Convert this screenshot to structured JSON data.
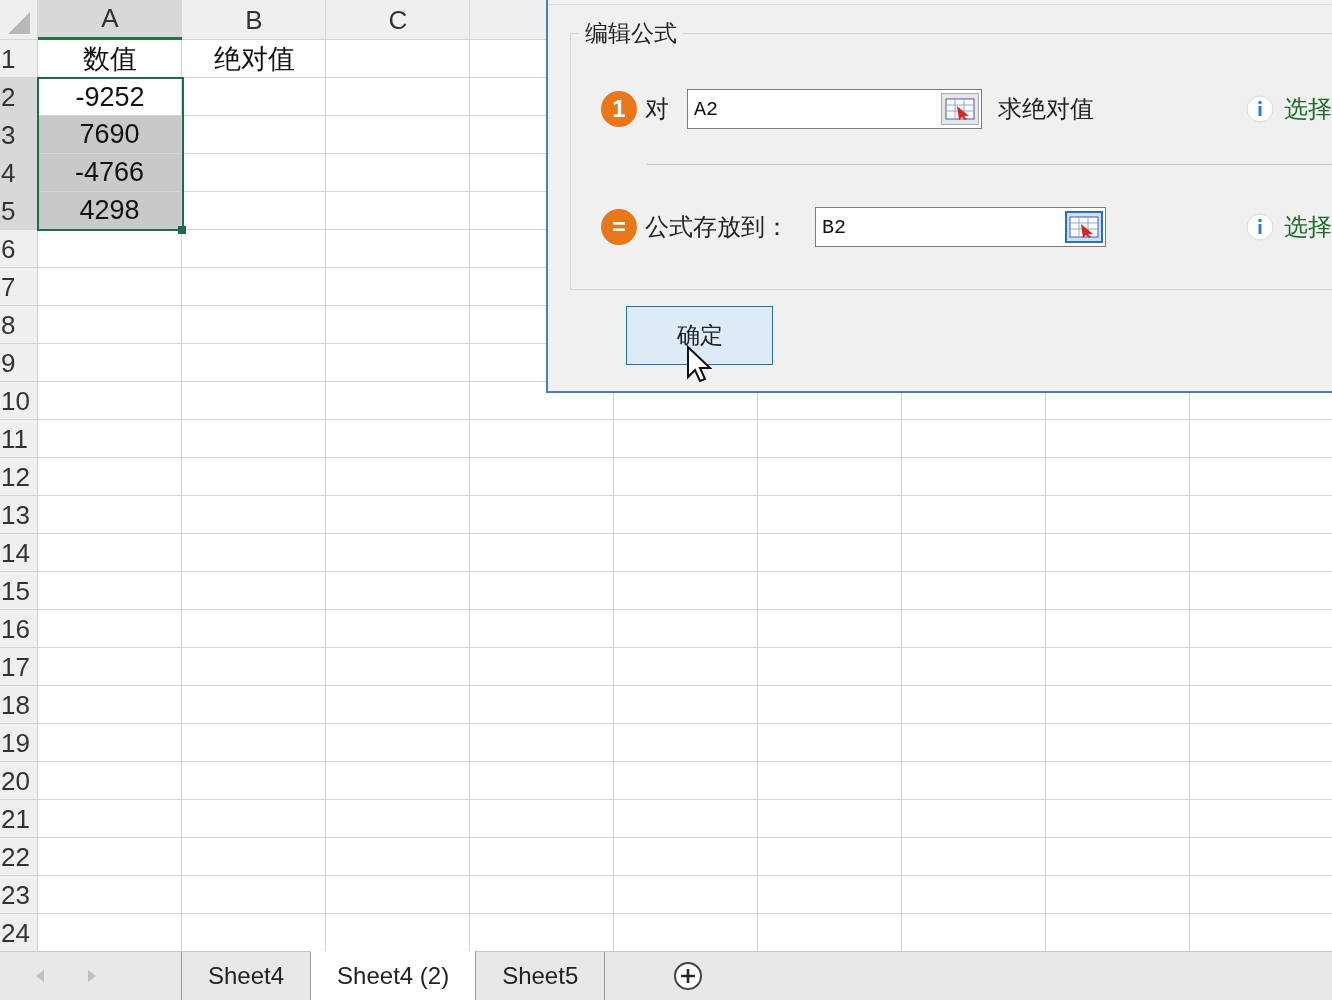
{
  "sheet": {
    "columns": [
      {
        "label": "A"
      },
      {
        "label": "B"
      },
      {
        "label": "C"
      }
    ],
    "rows": [
      {
        "header": "1",
        "cells": [
          {
            "text": "数值",
            "selected": false,
            "active": false
          },
          {
            "text": "绝对值",
            "selected": false,
            "active": false
          }
        ]
      },
      {
        "header": "2",
        "cells": [
          {
            "text": "-9252",
            "selected": false,
            "active": true
          }
        ]
      },
      {
        "header": "3",
        "cells": [
          {
            "text": "7690",
            "selected": true,
            "active": false
          }
        ]
      },
      {
        "header": "4",
        "cells": [
          {
            "text": "-4766",
            "selected": true,
            "active": false
          }
        ]
      },
      {
        "header": "5",
        "cells": [
          {
            "text": "4298",
            "selected": true,
            "active": false
          }
        ]
      },
      {
        "header": "6"
      },
      {
        "header": "7"
      },
      {
        "header": "8"
      },
      {
        "header": "9"
      },
      {
        "header": "10"
      },
      {
        "header": "11"
      },
      {
        "header": "12"
      },
      {
        "header": "13"
      },
      {
        "header": "14"
      },
      {
        "header": "15"
      },
      {
        "header": "16"
      },
      {
        "header": "17"
      },
      {
        "header": "18"
      },
      {
        "header": "19"
      },
      {
        "header": "20"
      },
      {
        "header": "21"
      },
      {
        "header": "22"
      },
      {
        "header": "23"
      },
      {
        "header": "24"
      }
    ]
  },
  "dialog": {
    "group_title": "编辑公式",
    "fields": [
      {
        "badge": "1",
        "prefix": "对",
        "value": "A2",
        "suffix": "求绝对值",
        "hint": "选择",
        "focused": false
      },
      {
        "badge": "=",
        "prefix": "公式存放到：",
        "value": "B2",
        "hint": "选择",
        "focused": true
      }
    ],
    "ok_button": "确定"
  },
  "sheet_tabs": [
    {
      "label": "Sheet4",
      "selected": false
    },
    {
      "label": "Sheet4 (2)",
      "selected": true
    },
    {
      "label": "Sheet5",
      "selected": false
    }
  ]
}
